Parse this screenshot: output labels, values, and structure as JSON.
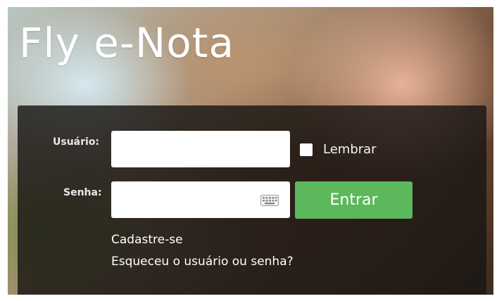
{
  "app": {
    "title": "Fly e-Nota"
  },
  "login": {
    "username_label": "Usuário:",
    "username_value": "",
    "password_label": "Senha:",
    "password_value": "",
    "remember_label": "Lembrar",
    "remember_checked": false,
    "submit_label": "Entrar",
    "register_link": "Cadastre-se",
    "forgot_link": "Esqueceu o usuário ou senha?"
  },
  "icons": {
    "keyboard": "keyboard-icon"
  },
  "colors": {
    "submit_button": "#5cb85c",
    "panel_background": "rgba(24,22,20,0.82)",
    "title_text": "#ffffff"
  }
}
